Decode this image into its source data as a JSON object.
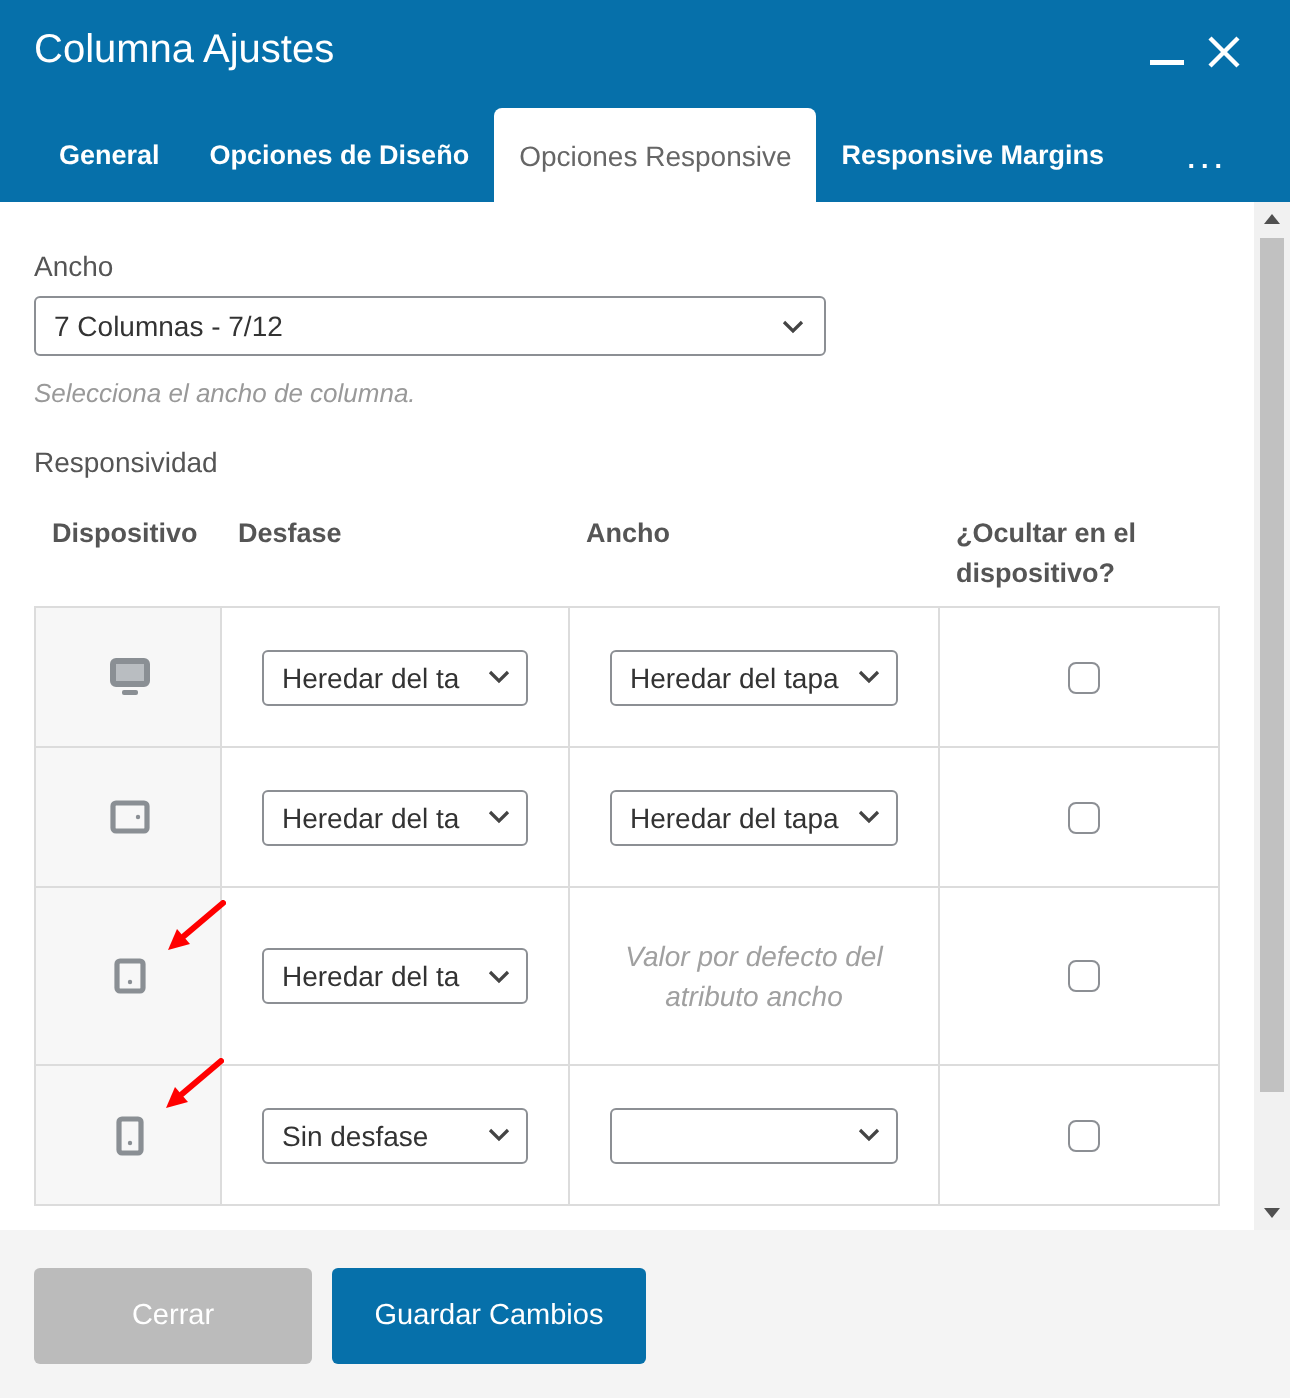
{
  "window": {
    "title": "Columna Ajustes"
  },
  "tabs": [
    {
      "label": "General",
      "selected": false
    },
    {
      "label": "Opciones de Diseño",
      "selected": false
    },
    {
      "label": "Opciones Responsive",
      "selected": true
    },
    {
      "label": "Responsive Margins",
      "selected": false
    },
    {
      "label": "...",
      "selected": false
    }
  ],
  "width_setting": {
    "label": "Ancho",
    "value": "7 Columnas - 7/12",
    "help": "Selecciona el ancho de columna."
  },
  "responsive": {
    "title": "Responsividad",
    "columns": [
      "Dispositivo",
      "Desfase",
      "Ancho",
      "¿Ocultar en el dispositivo?"
    ],
    "rows": [
      {
        "kind": "desktop",
        "offset": "Heredar del ta",
        "width": {
          "kind": "select",
          "value": "Heredar del tapa"
        },
        "hidden": false,
        "marked": false
      },
      {
        "kind": "tablet-landscape",
        "offset": "Heredar del ta",
        "width": {
          "kind": "select",
          "value": "Heredar del tapa"
        },
        "hidden": false,
        "marked": false
      },
      {
        "kind": "tablet-portrait",
        "offset": "Heredar del ta",
        "width": {
          "kind": "note",
          "text": "Valor por defecto del atributo ancho"
        },
        "hidden": false,
        "marked": true
      },
      {
        "kind": "phone",
        "offset": "Sin desfase",
        "width": {
          "kind": "select"
        },
        "hidden": false,
        "marked": true
      }
    ]
  },
  "buttons": [
    {
      "label": "Cerrar",
      "kind": "secondary"
    },
    {
      "label": "Guardar Cambios",
      "kind": "primary"
    }
  ]
}
